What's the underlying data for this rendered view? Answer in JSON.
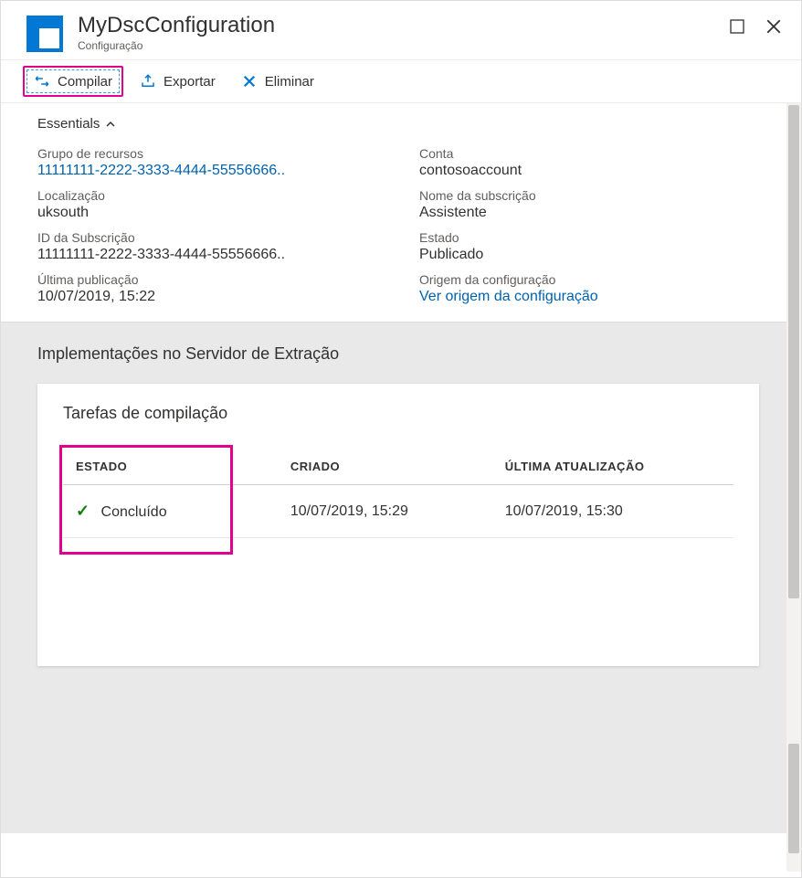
{
  "header": {
    "title": "MyDscConfiguration",
    "subtitle": "Configuração"
  },
  "toolbar": {
    "compile": "Compilar",
    "export": "Exportar",
    "delete": "Eliminar"
  },
  "essentials": {
    "toggle_label": "Essentials",
    "left": {
      "resource_group_label": "Grupo de recursos",
      "resource_group_value": "11111111-2222-3333-4444-55556666..",
      "location_label": "Localização",
      "location_value": "uksouth",
      "subscription_id_label": "ID da Subscrição",
      "subscription_id_value": "11111111-2222-3333-4444-55556666..",
      "last_published_label": "Última publicação",
      "last_published_value": "10/07/2019, 15:22"
    },
    "right": {
      "account_label": "Conta",
      "account_value": "contosoaccount",
      "subscription_name_label": "Nome da subscrição",
      "subscription_name_value": "Assistente",
      "status_label": "Estado",
      "status_value": "Publicado",
      "config_source_label": "Origem da configuração",
      "config_source_value": "Ver origem da configuração"
    }
  },
  "deploy_section": {
    "heading": "Implementações no Servidor de Extração",
    "card_title": "Tarefas de compilação",
    "col_status": "ESTADO",
    "col_created": "CRIADO",
    "col_updated": "ÚLTIMA ATUALIZAÇÃO",
    "rows": [
      {
        "status": "Concluído",
        "created": "10/07/2019, 15:29",
        "updated": "10/07/2019, 15:30"
      }
    ]
  }
}
